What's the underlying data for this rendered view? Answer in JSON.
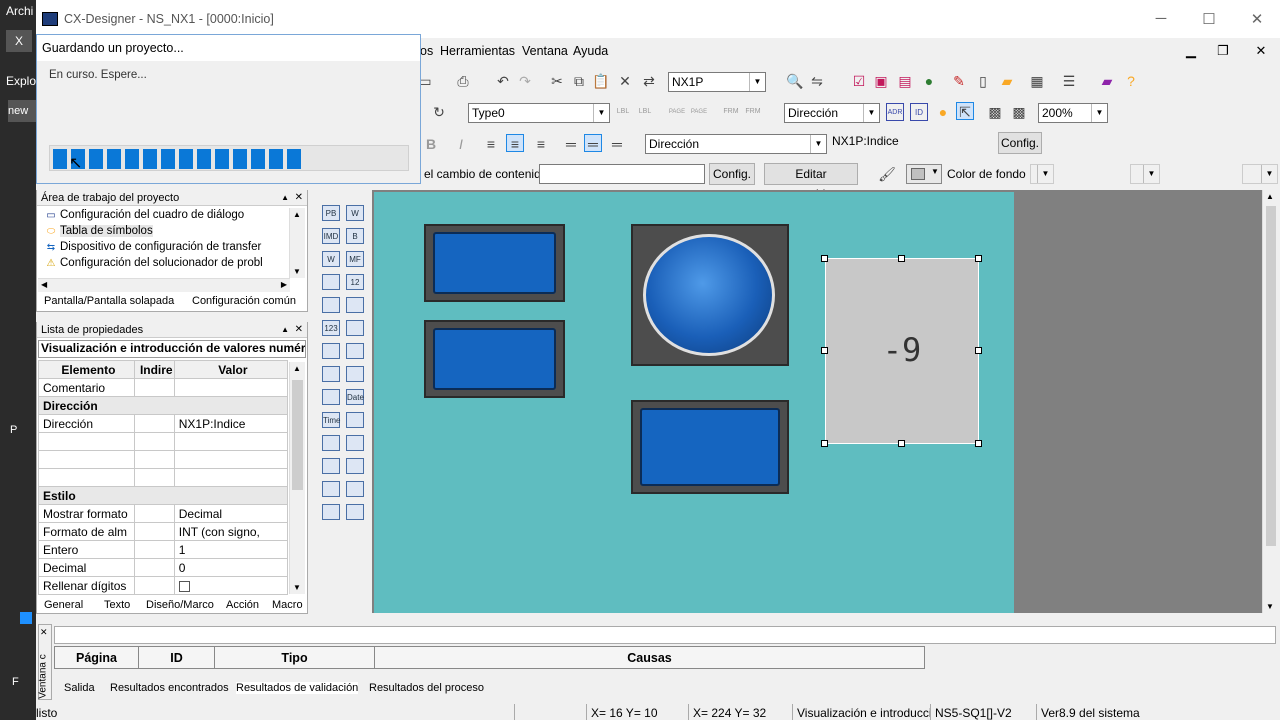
{
  "background": {
    "left_text1": "Archi",
    "left_btn1": "X",
    "left_text2": "Explo",
    "left_btn2": "new",
    "left_text3": "P",
    "left_text4": "F"
  },
  "window": {
    "title": "CX-Designer - NS_NX1 - [0000:Inicio]",
    "minimize": "─",
    "maximize": "☐",
    "close": "✕"
  },
  "menu": {
    "items": [
      "os",
      "Herramientas",
      "Ventana",
      "Ayuda"
    ]
  },
  "toolbar1": {
    "plc_combo": "NX1P"
  },
  "toolbar2": {
    "type_combo": "Type0",
    "address_combo": "Dirección",
    "zoom_combo": "200%",
    "icon_labels": [
      "LBL",
      "LBL",
      "PAGE",
      "PAGE",
      "FRM",
      "FRM",
      "ADR",
      "ID"
    ]
  },
  "toolbar3": {
    "address_combo": "Dirección",
    "address_value": "NX1P:Indice",
    "config_button": "Config."
  },
  "toolbar4": {
    "change_label": "el cambio de contenido",
    "config_button": "Config.",
    "edit_button": "Editar contenido...",
    "bg_color_label": "Color de fondo"
  },
  "project_panel": {
    "header": "Área de trabajo del proyecto",
    "items": [
      "Configuración del cuadro de diálogo",
      "Tabla de símbolos",
      "Dispositivo de configuración de transfer",
      "Configuración del solucionador de probl"
    ],
    "tabs": [
      "Pantalla/Pantalla solapada",
      "Configuración común"
    ]
  },
  "properties_panel": {
    "header": "Lista de propiedades",
    "object_title": "Visualización e introducción de valores numéri",
    "columns": [
      "Elemento",
      "Indire",
      "Valor"
    ],
    "rows": [
      {
        "type": "row",
        "name": "Comentario",
        "indirect": "",
        "value": ""
      },
      {
        "type": "section",
        "name": "Dirección"
      },
      {
        "type": "row",
        "name": "Dirección",
        "indirect": "",
        "value": "NX1P:Indice"
      },
      {
        "type": "row",
        "name": "",
        "indirect": "",
        "value": ""
      },
      {
        "type": "row",
        "name": "",
        "indirect": "",
        "value": ""
      },
      {
        "type": "row",
        "name": "",
        "indirect": "",
        "value": ""
      },
      {
        "type": "section",
        "name": "Estilo"
      },
      {
        "type": "row",
        "name": "Mostrar formato",
        "indirect": "",
        "value": "Decimal"
      },
      {
        "type": "row",
        "name": "Formato de alm",
        "indirect": "",
        "value": "INT (con signo,"
      },
      {
        "type": "row",
        "name": " Entero",
        "indirect": "",
        "value": "1"
      },
      {
        "type": "row",
        "name": " Decimal",
        "indirect": "",
        "value": "0"
      },
      {
        "type": "row",
        "name": "Rellenar dígitos",
        "indirect": "",
        "value": ""
      }
    ],
    "tabs": [
      "General",
      "Texto",
      "Diseño/Marco",
      "Acción",
      "Macro"
    ]
  },
  "palette": {
    "labels": [
      "PB",
      "W",
      "IMD",
      "B",
      "W",
      "MF",
      "",
      "12",
      "",
      "",
      "123",
      "",
      "",
      "",
      "",
      "",
      "",
      "Date",
      "Time",
      "",
      "",
      "",
      "",
      "",
      "",
      "",
      "",
      ""
    ]
  },
  "canvas": {
    "numeric_value": "-9"
  },
  "dialog": {
    "title": "Guardando un proyecto...",
    "message": "En curso. Espere...",
    "progress_segments": 14
  },
  "output_panel": {
    "side_label": "Ventana c",
    "columns": [
      "Página",
      "ID",
      "Tipo",
      "Causas"
    ],
    "tabs": [
      "Salida",
      "Resultados encontrados",
      "Resultados de validación",
      "Resultados del proceso"
    ]
  },
  "statusbar": {
    "status": "listo",
    "xy1": "X=  16 Y=  10",
    "xy2": "X= 224 Y=  32",
    "object": "Visualización e introducci",
    "device": "NS5-SQ1[]-V2",
    "version": "Ver8.9 del sistema"
  }
}
